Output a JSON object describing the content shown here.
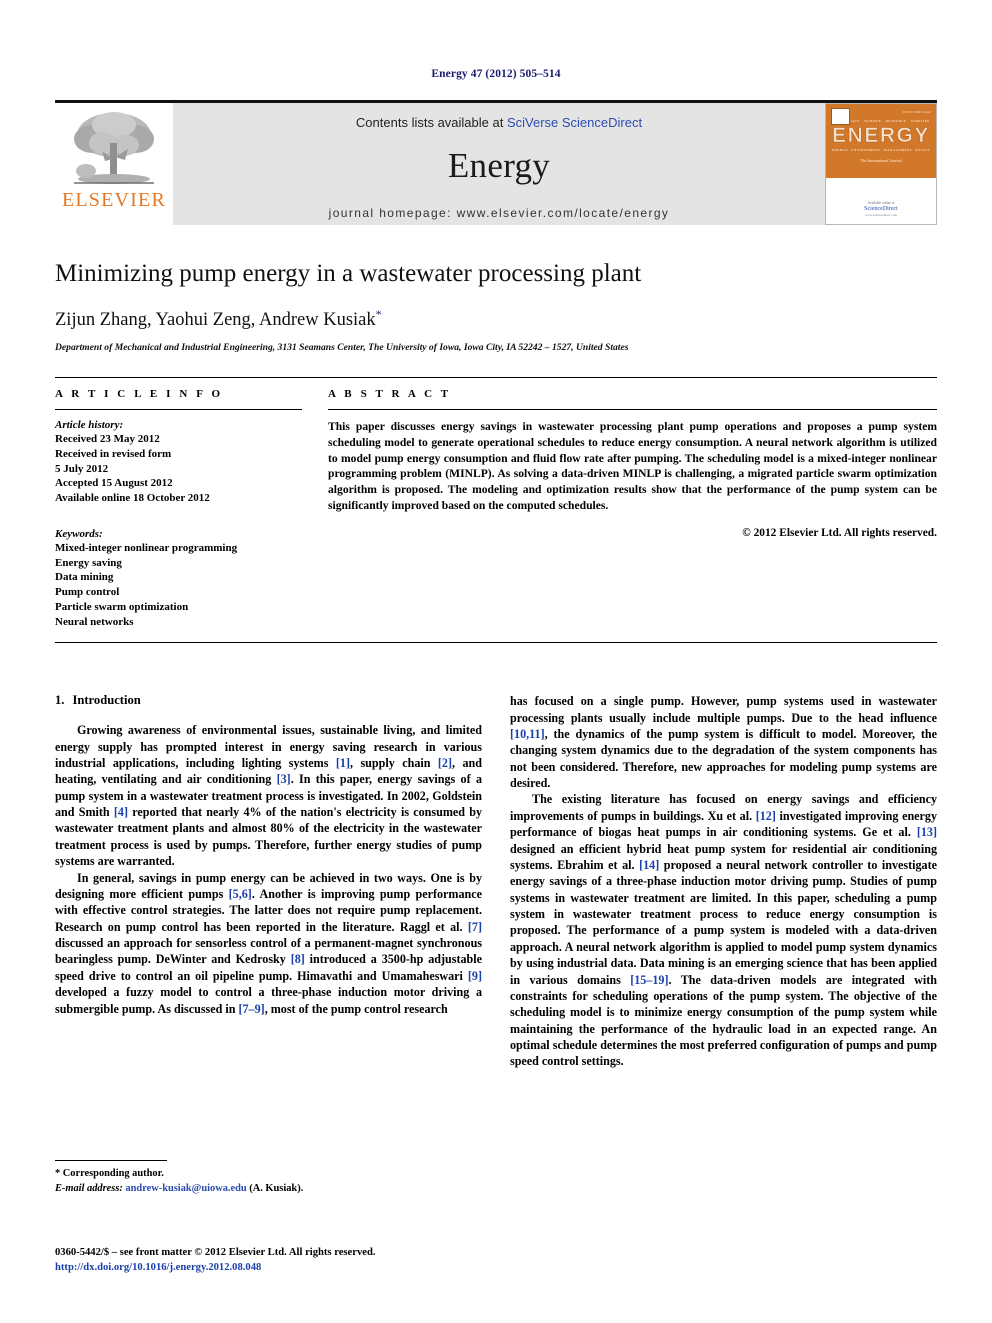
{
  "running_head": "Energy 47 (2012) 505–514",
  "masthead": {
    "publisher_name": "ELSEVIER",
    "contents_prefix": "Contents lists available at ",
    "contents_link": "SciVerse ScienceDirect",
    "journal_name": "Energy",
    "homepage": "journal homepage: www.elsevier.com/locate/energy",
    "cover": {
      "title": "ENERGY",
      "subtitle": "The International Journal",
      "code": "ISSN 0360-5442",
      "topics_row1": [
        "TECHNOLOGY",
        "SCIENCE",
        "RESOURCE",
        "SUPPLIES"
      ],
      "topics_row2": [
        "ENERGY",
        "ENVIRONMENT",
        "MANAGEMENT",
        "POLICY"
      ],
      "available_at": "Available online at",
      "sciencedirect": "ScienceDirect",
      "url": "www.sciencedirect.com"
    }
  },
  "article": {
    "title": "Minimizing pump energy in a wastewater processing plant",
    "authors": "Zijun Zhang, Yaohui Zeng, Andrew Kusiak",
    "corresponding_marker": "*",
    "affiliation": "Department of Mechanical and Industrial Engineering, 3131 Seamans Center, The University of Iowa, Iowa City, IA 52242 – 1527, United States"
  },
  "article_info": {
    "heading": "A R T I C L E   I N F O",
    "history_label": "Article history:",
    "history": [
      "Received 23 May 2012",
      "Received in revised form",
      "5 July 2012",
      "Accepted 15 August 2012",
      "Available online 18 October 2012"
    ],
    "keywords_label": "Keywords:",
    "keywords": [
      "Mixed-integer nonlinear programming",
      "Energy saving",
      "Data mining",
      "Pump control",
      "Particle swarm optimization",
      "Neural networks"
    ]
  },
  "abstract": {
    "heading": "A B S T R A C T",
    "text": "This paper discusses energy savings in wastewater processing plant pump operations and proposes a pump system scheduling model to generate operational schedules to reduce energy consumption. A neural network algorithm is utilized to model pump energy consumption and fluid flow rate after pumping. The scheduling model is a mixed-integer nonlinear programming problem (MINLP). As solving a data-driven MINLP is challenging, a migrated particle swarm optimization algorithm is proposed. The modeling and optimization results show that the performance of the pump system can be significantly improved based on the computed schedules.",
    "copyright": "© 2012 Elsevier Ltd. All rights reserved."
  },
  "body": {
    "section_number": "1.",
    "section_title": "Introduction",
    "left_paragraphs": [
      "Growing awareness of environmental issues, sustainable living, and limited energy supply has prompted interest in energy saving research in various industrial applications, including lighting systems [1], supply chain [2], and heating, ventilating and air conditioning [3]. In this paper, energy savings of a pump system in a wastewater treatment process is investigated. In 2002, Goldstein and Smith [4] reported that nearly 4% of the nation's electricity is consumed by wastewater treatment plants and almost 80% of the electricity in the wastewater treatment process is used by pumps. Therefore, further energy studies of pump systems are warranted.",
      "In general, savings in pump energy can be achieved in two ways. One is by designing more efficient pumps [5,6]. Another is improving pump performance with effective control strategies. The latter does not require pump replacement. Research on pump control has been reported in the literature. Raggl et al. [7] discussed an approach for sensorless control of a permanent-magnet synchronous bearingless pump. DeWinter and Kedrosky [8] introduced a 3500-hp adjustable speed drive to control an oil pipeline pump. Himavathi and Umamaheswari [9] developed a fuzzy model to control a three-phase induction motor driving a submergible pump. As discussed in [7–9], most of the pump control research"
    ],
    "right_paragraphs": [
      "has focused on a single pump. However, pump systems used in wastewater processing plants usually include multiple pumps. Due to the head influence [10,11], the dynamics of the pump system is difficult to model. Moreover, the changing system dynamics due to the degradation of the system components has not been considered. Therefore, new approaches for modeling pump systems are desired.",
      "The existing literature has focused on energy savings and efficiency improvements of pumps in buildings. Xu et al. [12] investigated improving energy performance of biogas heat pumps in air conditioning systems. Ge et al. [13] designed an efficient hybrid heat pump system for residential air conditioning systems. Ebrahim et al. [14] proposed a neural network controller to investigate energy savings of a three-phase induction motor driving pump. Studies of pump systems in wastewater treatment are limited. In this paper, scheduling a pump system in wastewater treatment process to reduce energy consumption is proposed. The performance of a pump system is modeled with a data-driven approach. A neural network algorithm is applied to model pump system dynamics by using industrial data. Data mining is an emerging science that has been applied in various domains [15–19]. The data-driven models are integrated with constraints for scheduling operations of the pump system. The objective of the scheduling model is to minimize energy consumption of the pump system while maintaining the performance of the hydraulic load in an expected range. An optimal schedule determines the most preferred configuration of pumps and pump speed control settings."
    ]
  },
  "footnote": {
    "corresponding": "* Corresponding author.",
    "email_label": "E-mail address:",
    "email": "andrew-kusiak@uiowa.edu",
    "email_suffix": " (A. Kusiak)."
  },
  "imprint": {
    "issn_line": "0360-5442/$ – see front matter © 2012 Elsevier Ltd. All rights reserved.",
    "doi": "http://dx.doi.org/10.1016/j.energy.2012.08.048"
  },
  "colors": {
    "link_blue": "#2b4cb0",
    "ref_blue": "#1a3faa",
    "elsevier_orange": "#E87722",
    "masthead_gray": "#e4e4e4",
    "running_head_navy": "#1a1a6e"
  }
}
